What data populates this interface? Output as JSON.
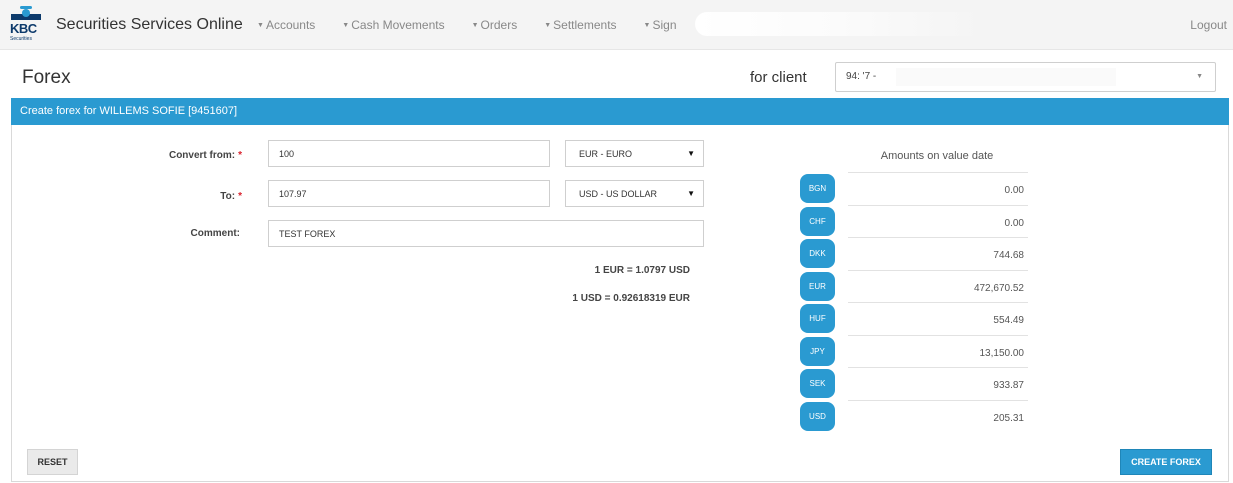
{
  "header": {
    "logo_text": "KBC",
    "logo_sub": "Securities",
    "app_title": "Securities Services Online",
    "nav": [
      "Accounts",
      "Cash Movements",
      "Orders",
      "Settlements",
      "Sign"
    ],
    "logout": "Logout"
  },
  "page": {
    "title": "Forex",
    "for_client_label": "for client",
    "client_value": "94:   '7 -"
  },
  "panel": {
    "title": "Create forex for WILLEMS SOFIE [9451607]"
  },
  "form": {
    "convert_from_label": "Convert from:",
    "convert_from_value": "100",
    "convert_from_currency": "EUR - EURO",
    "to_label": "To:",
    "to_value": "107.97",
    "to_currency": "USD - US DOLLAR",
    "comment_label": "Comment:",
    "comment_value": "TEST FOREX",
    "required_mark": "*"
  },
  "rates": {
    "rate1": "1 EUR = 1.0797 USD",
    "rate2": "1 USD = 0.92618319 EUR"
  },
  "balances": {
    "title": "Amounts on value date",
    "rows": [
      {
        "ccy": "BGN",
        "amount": "0.00"
      },
      {
        "ccy": "CHF",
        "amount": "0.00"
      },
      {
        "ccy": "DKK",
        "amount": "744.68"
      },
      {
        "ccy": "EUR",
        "amount": "472,670.52"
      },
      {
        "ccy": "HUF",
        "amount": "554.49"
      },
      {
        "ccy": "JPY",
        "amount": "13,150.00"
      },
      {
        "ccy": "SEK",
        "amount": "933.87"
      },
      {
        "ccy": "USD",
        "amount": "205.31"
      }
    ]
  },
  "buttons": {
    "reset": "RESET",
    "create": "CREATE FOREX"
  },
  "colors": {
    "accent": "#2a9ad1",
    "required": "#d9232e",
    "logo": "#0d3a6b"
  }
}
